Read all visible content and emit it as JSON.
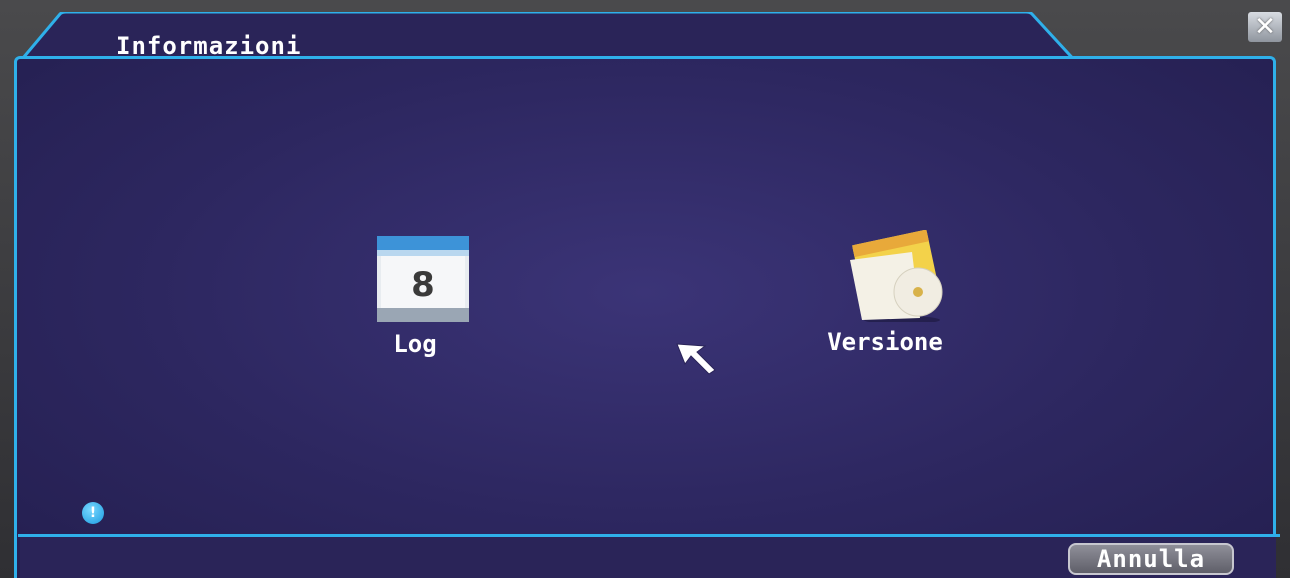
{
  "window": {
    "title": "Informazioni",
    "close_label": "✕"
  },
  "menu": {
    "items": [
      {
        "label": "Log",
        "icon": "calendar-icon",
        "calendar_day": "8"
      },
      {
        "label": "Versione",
        "icon": "disc-folder-icon"
      }
    ]
  },
  "footer": {
    "info_symbol": "!",
    "cancel_label": "Annulla"
  },
  "colors": {
    "panel_bg": "#2d2760",
    "border_accent": "#2fb0ea",
    "text": "#ffffff"
  }
}
